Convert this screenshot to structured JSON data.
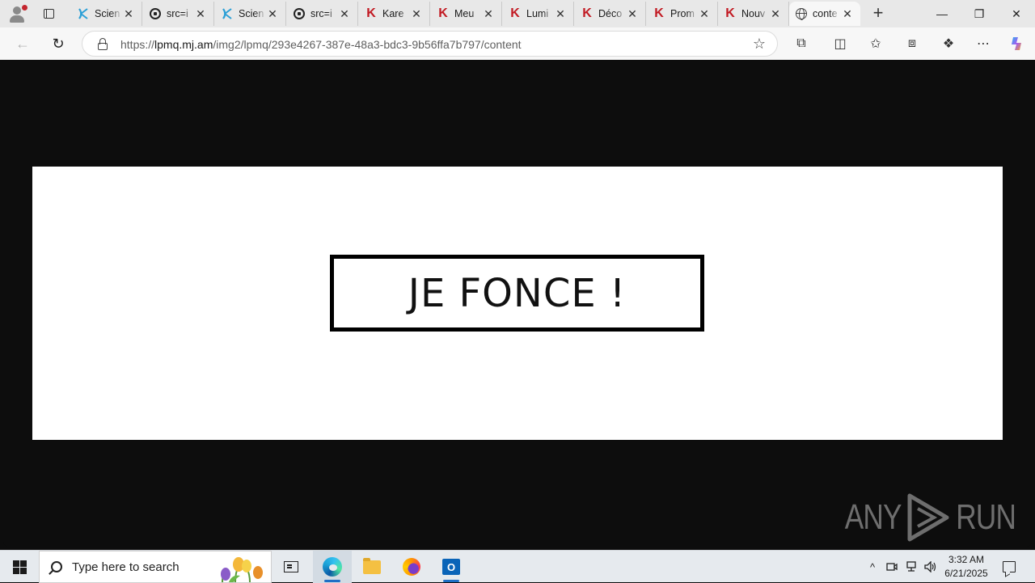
{
  "browser": {
    "tabs": [
      {
        "title": "Scien",
        "favicon": "kinder-science-icon"
      },
      {
        "title": "src=i",
        "favicon": "lock-circle-icon"
      },
      {
        "title": "Scien",
        "favicon": "kinder-science-icon"
      },
      {
        "title": "src=i",
        "favicon": "lock-circle-icon"
      },
      {
        "title": "Kare",
        "favicon": "k-logo-icon"
      },
      {
        "title": "Meu",
        "favicon": "k-logo-icon"
      },
      {
        "title": "Lumi",
        "favicon": "k-logo-icon"
      },
      {
        "title": "Déco",
        "favicon": "k-logo-icon"
      },
      {
        "title": "Prom",
        "favicon": "k-logo-icon"
      },
      {
        "title": "Nouv",
        "favicon": "k-logo-icon"
      },
      {
        "title": "conte",
        "favicon": "globe-icon",
        "active": true
      }
    ],
    "close_glyph": "✕",
    "new_tab_glyph": "+",
    "window_controls": {
      "minimize": "—",
      "maximize": "❐",
      "close": "✕"
    },
    "address": {
      "prefix": "https://",
      "host": "lpmq.mj.am",
      "path": "/img2/lpmq/293e4267-387e-48a3-bdc3-9b56ffa7b797/content"
    },
    "nav": {
      "back": "←",
      "reload": "↻",
      "favorite": "☆"
    },
    "toolbar_icons": {
      "extensions": "⧉",
      "split": "◫",
      "favorites": "✩",
      "collections": "⧈",
      "performance": "❖",
      "more": "⋯"
    }
  },
  "page": {
    "cta_text": "JE FONCE !",
    "banner_bg": "#ffffff",
    "page_bg": "#0d0d0d",
    "border_color": "#000000"
  },
  "watermark": {
    "left": "ANY",
    "right": "RUN"
  },
  "taskbar": {
    "search_placeholder": "Type here to search",
    "time": "3:32 AM",
    "date": "6/21/2025",
    "tray": {
      "chevron": "^",
      "network": "⊡",
      "volume": "🕪"
    }
  }
}
